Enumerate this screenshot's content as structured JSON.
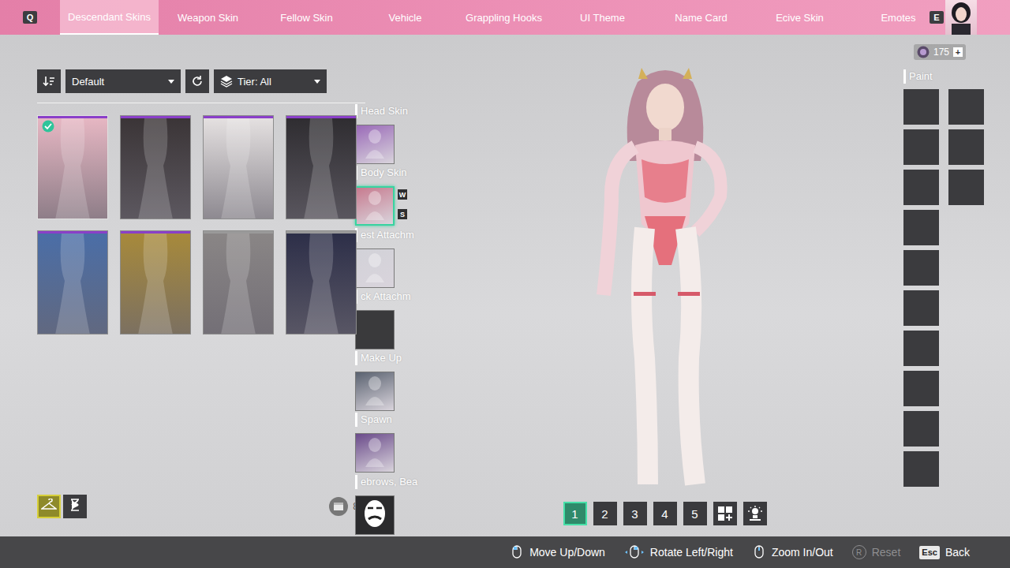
{
  "top_tabs": {
    "left_key": "Q",
    "right_key": "E",
    "items": [
      {
        "label": "Descendant Skins",
        "selected": true
      },
      {
        "label": "Weapon Skin",
        "selected": false
      },
      {
        "label": "Fellow Skin",
        "selected": false
      },
      {
        "label": "Vehicle",
        "selected": false
      },
      {
        "label": "Grappling Hooks",
        "selected": false
      },
      {
        "label": "UI Theme",
        "selected": false
      },
      {
        "label": "Name Card",
        "selected": false
      },
      {
        "label": "Ecive Skin",
        "selected": false
      },
      {
        "label": "Emotes",
        "selected": false
      }
    ]
  },
  "currency": {
    "amount": "175",
    "add": "+"
  },
  "filters": {
    "sort": "Default",
    "tier": "Tier: All"
  },
  "skins": [
    {
      "kind": "ultimate",
      "color": "#e8b8c4",
      "selected": true
    },
    {
      "kind": "ultimate",
      "color": "#3a3436",
      "selected": false
    },
    {
      "kind": "ultimate",
      "color": "#e6e2e2",
      "selected": false
    },
    {
      "kind": "ultimate",
      "color": "#2e2c30",
      "selected": false
    },
    {
      "kind": "ultimate",
      "color": "#4a6ea8",
      "selected": false
    },
    {
      "kind": "ultimate",
      "color": "#a88a3a",
      "selected": false
    },
    {
      "kind": "standard",
      "color": "#8a8686",
      "selected": false
    },
    {
      "kind": "standard",
      "color": "#2c2e48",
      "selected": false
    }
  ],
  "view_modes": [
    {
      "kind": "hanger",
      "selected": true
    },
    {
      "kind": "hourglass",
      "selected": false
    }
  ],
  "inventory_count": "8",
  "slots": [
    {
      "label": "Head Skin",
      "kind": "image",
      "color": "#9a6ab8",
      "selected": false,
      "badges": []
    },
    {
      "label": "Body Skin",
      "kind": "image",
      "color": "#c77b8f",
      "selected": true,
      "badges": [
        "W",
        "S"
      ]
    },
    {
      "label": "est Attachm",
      "kind": "image",
      "color": "#d2d2d8",
      "selected": false,
      "badges": []
    },
    {
      "label": "ck Attachm",
      "kind": "empty",
      "color": "#3a3a3c",
      "selected": false,
      "badges": []
    },
    {
      "label": "Make Up",
      "kind": "image",
      "color": "#5a6270",
      "selected": false,
      "badges": []
    },
    {
      "label": "Spawn",
      "kind": "image",
      "color": "#6a4a8a",
      "selected": false,
      "badges": []
    },
    {
      "label": "ebrows, Bea",
      "kind": "icon",
      "color": "#2b2b2d",
      "selected": false,
      "badges": []
    }
  ],
  "paint": {
    "label": "Paint",
    "swatches": [
      {
        "filled": false
      },
      {
        "filled": false
      },
      {
        "filled": false
      },
      {
        "filled": false
      },
      {
        "filled": false
      },
      {
        "filled": false
      },
      {
        "filled": false
      },
      {
        "filled": false
      },
      {
        "filled": false
      },
      {
        "filled": false
      },
      {
        "filled": false
      },
      {
        "filled": false
      },
      {
        "filled": false
      }
    ]
  },
  "presets": [
    {
      "label": "1",
      "selected": true
    },
    {
      "label": "2",
      "selected": false
    },
    {
      "label": "3",
      "selected": false
    },
    {
      "label": "4",
      "selected": false
    },
    {
      "label": "5",
      "selected": false
    }
  ],
  "hints": [
    {
      "kind": "mouse-move",
      "label": "Move Up/Down",
      "disabled": false
    },
    {
      "kind": "mouse-drag",
      "label": "Rotate Left/Right",
      "disabled": false
    },
    {
      "kind": "mouse-wheel",
      "label": "Zoom In/Out",
      "disabled": false
    },
    {
      "kind": "key-round",
      "key": "R",
      "label": "Reset",
      "disabled": true
    },
    {
      "kind": "key",
      "key": "Esc",
      "label": "Back",
      "disabled": false
    }
  ]
}
